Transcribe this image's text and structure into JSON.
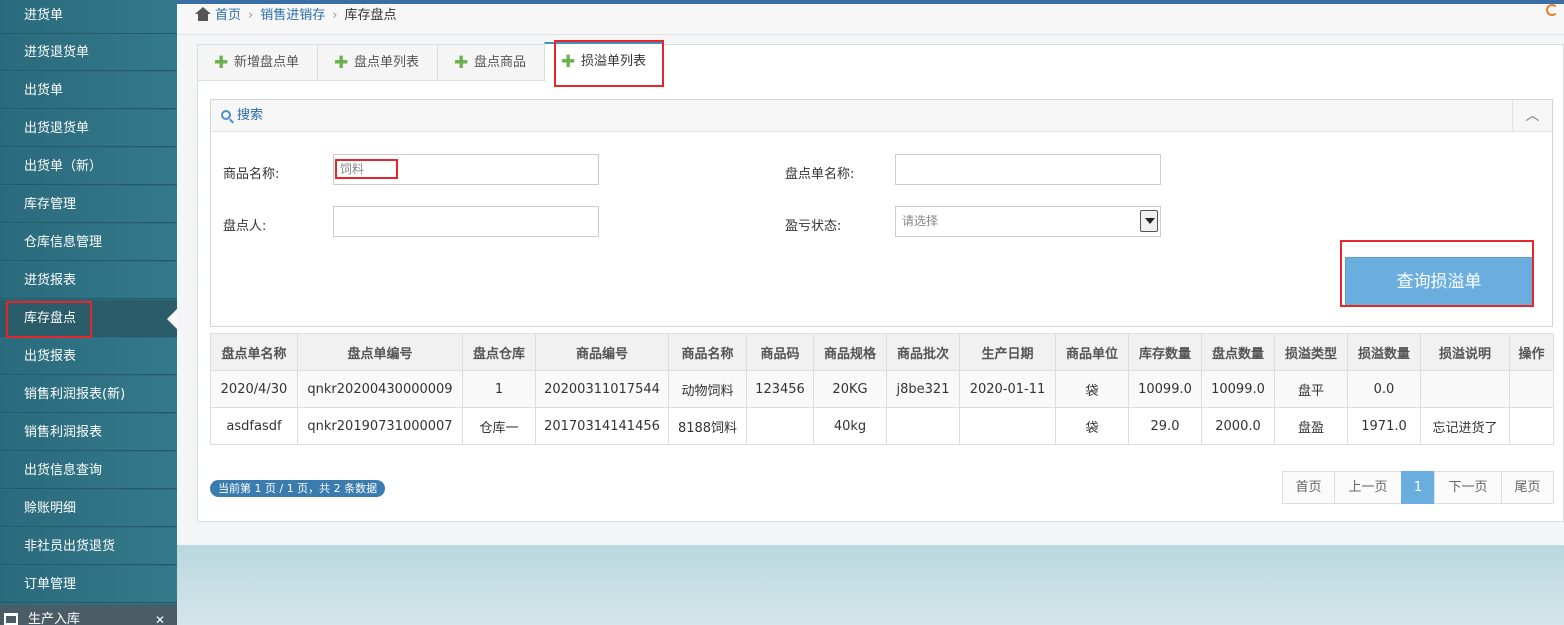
{
  "sidebar": {
    "items": [
      {
        "label": "进货单"
      },
      {
        "label": "进货退货单"
      },
      {
        "label": "出货单"
      },
      {
        "label": "出货退货单"
      },
      {
        "label": "出货单（新）"
      },
      {
        "label": "库存管理"
      },
      {
        "label": "仓库信息管理"
      },
      {
        "label": "进货报表"
      },
      {
        "label": "库存盘点"
      },
      {
        "label": "出货报表"
      },
      {
        "label": "销售利润报表(新)"
      },
      {
        "label": "销售利润报表"
      },
      {
        "label": "出货信息查询"
      },
      {
        "label": "赊账明细"
      },
      {
        "label": "非社员出货退货"
      },
      {
        "label": "订单管理"
      }
    ],
    "section_label": "生产入库",
    "active_index": 8
  },
  "breadcrumb": {
    "home": "首页",
    "level1": "销售进销存",
    "current": "库存盘点"
  },
  "tabs": [
    {
      "label": "新增盘点单"
    },
    {
      "label": "盘点单列表"
    },
    {
      "label": "盘点商品"
    },
    {
      "label": "损溢单列表"
    }
  ],
  "search": {
    "title": "搜索",
    "product_name_label": "商品名称:",
    "product_name_value": "饲料",
    "sheet_name_label": "盘点单名称:",
    "sheet_name_value": "",
    "checker_label": "盘点人:",
    "checker_value": "",
    "status_label": "盈亏状态:",
    "status_placeholder": "请选择",
    "query_button": "查询损溢单"
  },
  "table": {
    "headers": [
      "盘点单名称",
      "盘点单编号",
      "盘点仓库",
      "商品编号",
      "商品名称",
      "商品码",
      "商品规格",
      "商品批次",
      "生产日期",
      "商品单位",
      "库存数量",
      "盘点数量",
      "损溢类型",
      "损溢数量",
      "损溢说明",
      "操作"
    ],
    "rows": [
      [
        "2020/4/30",
        "qnkr20200430000009",
        "1",
        "20200311017544",
        "动物饲料",
        "123456",
        "20KG",
        "j8be321",
        "2020-01-11",
        "袋",
        "10099.0",
        "10099.0",
        "盘平",
        "0.0",
        "",
        ""
      ],
      [
        "asdfasdf",
        "qnkr20190731000007",
        "仓库一",
        "20170314141456",
        "8188饲料",
        "",
        "40kg",
        "",
        "",
        "袋",
        "29.0",
        "2000.0",
        "盘盈",
        "1971.0",
        "忘记进货了",
        ""
      ]
    ]
  },
  "pagination": {
    "info": "当前第 1 页 / 1 页，共 2 条数据",
    "first": "首页",
    "prev": "上一页",
    "current": "1",
    "next": "下一页",
    "last": "尾页"
  }
}
